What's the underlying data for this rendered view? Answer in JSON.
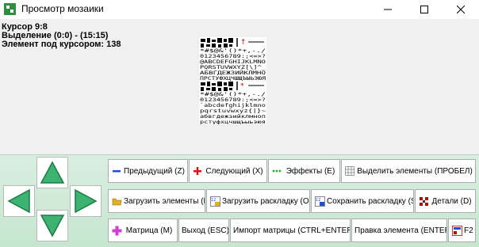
{
  "window": {
    "title": "Просмотр мозаики"
  },
  "info": {
    "cursor": "Курсор 9:8",
    "selection": "Выделение (0:0) - (15:15)",
    "element": "Элемент под курсором: 138"
  },
  "buttons": {
    "prev": "Предыдущий (Z)",
    "next": "Следующий (X)",
    "effects": "Эффекты (E)",
    "select_elements": "Выделить элементы (ПРОБЕЛ)",
    "load_elements": "Загрузить элементы (L)",
    "load_layout": "Загрузить раскладку (O)",
    "save_layout": "Сохранить раскладку (S)",
    "details": "Детали (D)",
    "matrix": "Матрица (M)",
    "exit": "Выход (ESC)",
    "import_matrix": "Импорт матрицы (CTRL+ENTER)",
    "edit_element": "Правка элемента (ENTER)",
    "f2": "F2"
  },
  "mosaic": {
    "rows": [
      "*#$@&'()*+,-./",
      "0123456789:;<=>?",
      "@ABCDEFGHIJKLMNO",
      "PQRSTUVWXYZ[\\]^_",
      "АБВГДЕЖЗИЙКЛМНО",
      "ПРСТУФХЦЧШЩЪЫЬЭЮЯ",
      "*#$@&'()*+,-./",
      "0123456789:;<=>?",
      "`abcdefghijklmno",
      "pqrstuvwxyz{|}~",
      "абвгдежзийклмноп",
      "рстуфхцчшщъыьэюя"
    ]
  },
  "colors": {
    "accent_green": "#3cb371",
    "panel_bg": "#c6e6cf"
  }
}
